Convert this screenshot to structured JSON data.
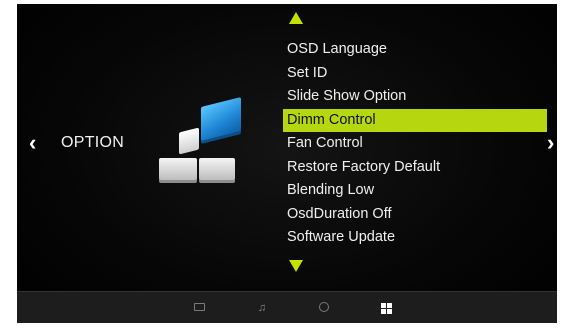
{
  "nav": {
    "left_arrow": "‹",
    "right_arrow": "›",
    "section_label": "OPTION"
  },
  "menu": {
    "items": [
      {
        "label": "OSD Language"
      },
      {
        "label": "Set ID"
      },
      {
        "label": "Slide Show Option"
      },
      {
        "label": "Dimm Control",
        "selected": true
      },
      {
        "label": "Fan Control"
      },
      {
        "label": "Restore Factory Default"
      },
      {
        "label": "Blending Low"
      },
      {
        "label": "OsdDuration Off"
      },
      {
        "label": "Software Update"
      }
    ],
    "highlight_color": "#b6d60f",
    "arrow_color": "#c6e000"
  },
  "bottom_bar": {
    "icons": [
      "tv-icon",
      "music-icon",
      "clock-icon",
      "option-grid-icon"
    ],
    "active": "option-grid-icon"
  }
}
